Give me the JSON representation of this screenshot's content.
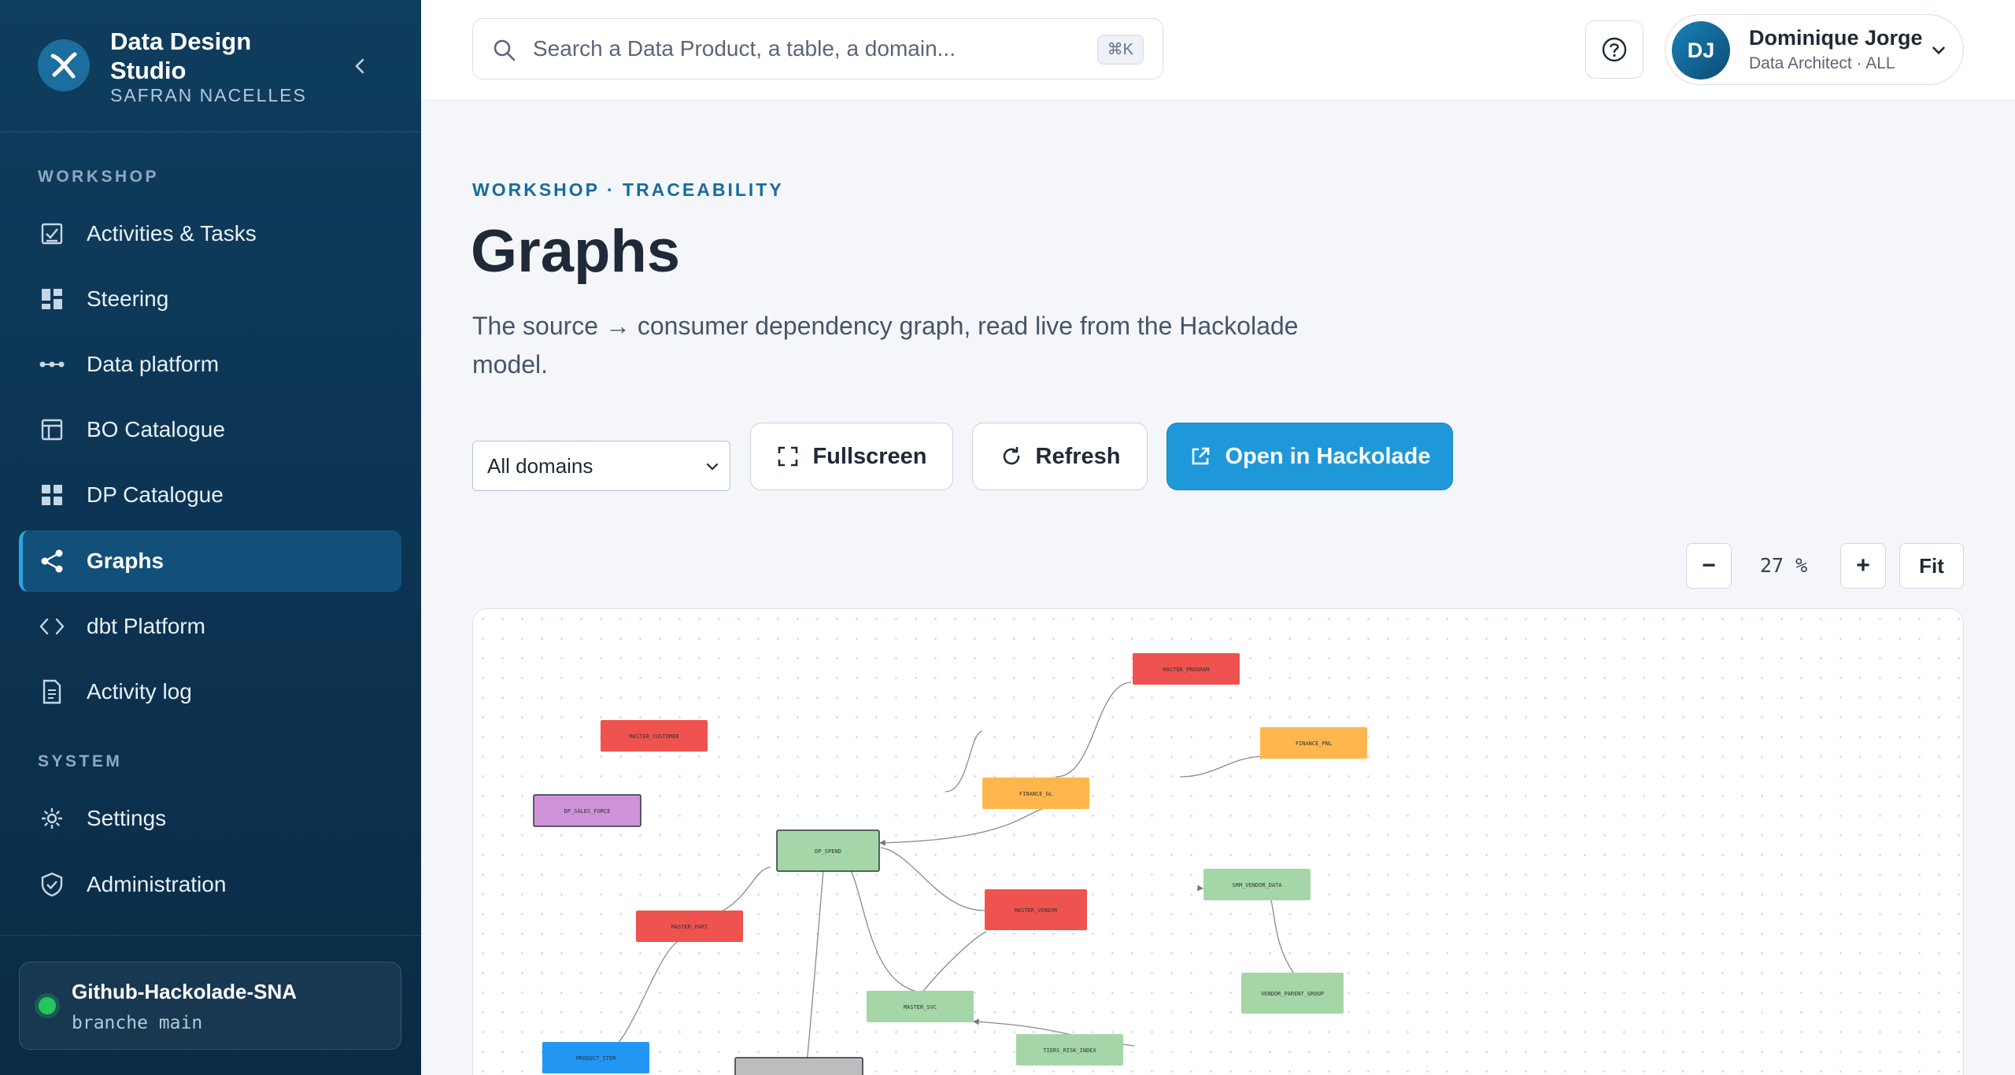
{
  "brand": {
    "title": "Data Design Studio",
    "subtitle": "SAFRAN NACELLES"
  },
  "sidebar": {
    "workshop_label": "WORKSHOP",
    "system_label": "SYSTEM",
    "workshop_items": [
      {
        "label": "Activities & Tasks",
        "icon": "checklist-icon"
      },
      {
        "label": "Steering",
        "icon": "dashboard-icon"
      },
      {
        "label": "Data platform",
        "icon": "pipeline-icon"
      },
      {
        "label": "BO Catalogue",
        "icon": "layout-icon"
      },
      {
        "label": "DP Catalogue",
        "icon": "grid-icon"
      },
      {
        "label": "Graphs",
        "icon": "share-icon",
        "active": true
      },
      {
        "label": "dbt Platform",
        "icon": "code-icon"
      },
      {
        "label": "Activity log",
        "icon": "document-icon"
      }
    ],
    "system_items": [
      {
        "label": "Settings",
        "icon": "gear-icon"
      },
      {
        "label": "Administration",
        "icon": "shield-icon"
      }
    ],
    "repo": {
      "name": "Github-Hackolade-SNA",
      "branch": "branche main",
      "status_color": "#22c55e"
    }
  },
  "search": {
    "placeholder": "Search a Data Product, a table, a domain...",
    "shortcut": "⌘K"
  },
  "user": {
    "initials": "DJ",
    "name": "Dominique Jorge",
    "role": "Data Architect · ALL"
  },
  "page": {
    "breadcrumb": "WORKSHOP · TRACEABILITY",
    "title": "Graphs",
    "description": "The source → consumer dependency graph, read live from the Hackolade model."
  },
  "toolbar": {
    "domain_select": "All domains",
    "fullscreen_label": "Fullscreen",
    "refresh_label": "Refresh",
    "open_label": "Open in Hackolade"
  },
  "zoom": {
    "minus": "−",
    "value": "27 %",
    "plus": "+",
    "fit": "Fit"
  },
  "colors": {
    "accent": "#1e98d8",
    "master": "#ef5350",
    "finance": "#ffb74d",
    "dp": "#a5d6a7",
    "sales": "#ce93d8",
    "product": "#2196f3",
    "neutral": "#bdbdbd"
  },
  "graph": {
    "nodes": [
      {
        "id": "MASTER_PROGRAM",
        "color": "#ef5350"
      },
      {
        "id": "FINANCE_PNL",
        "color": "#ffb74d"
      },
      {
        "id": "FINANCE_GL",
        "color": "#ffb74d"
      },
      {
        "id": "MASTER_CUSTOMER",
        "color": "#ef5350"
      },
      {
        "id": "DP_SALES_FORCE",
        "color": "#ce93d8"
      },
      {
        "id": "DP_SPEND",
        "color": "#a5d6a7"
      },
      {
        "id": "MASTER_VENDOR",
        "color": "#ef5350"
      },
      {
        "id": "SRM_VENDOR_DATA",
        "color": "#a5d6a7"
      },
      {
        "id": "MASTER_PART",
        "color": "#ef5350"
      },
      {
        "id": "VENDOR_PARENT_GROUP",
        "color": "#a5d6a7"
      },
      {
        "id": "MASTER_SVC",
        "color": "#a5d6a7"
      },
      {
        "id": "TIERS_RISK_INDEX",
        "color": "#a5d6a7"
      },
      {
        "id": "PRODUCT_ITEM",
        "color": "#2196f3"
      },
      {
        "id": "",
        "color": "#bdbdbd"
      }
    ]
  }
}
